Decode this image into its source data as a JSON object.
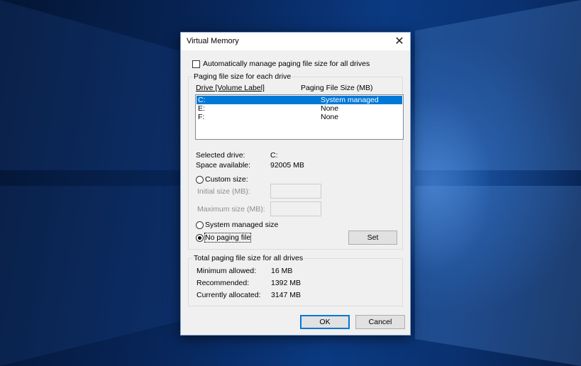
{
  "window": {
    "title": "Virtual Memory"
  },
  "auto_manage": {
    "label": "Automatically manage paging file size for all drives",
    "checked": false
  },
  "paging_group": {
    "title": "Paging file size for each drive",
    "headers": {
      "drive": "Drive  [Volume Label]",
      "size": "Paging File Size (MB)"
    },
    "rows": [
      {
        "drive": "C:",
        "size": "System managed",
        "selected": true
      },
      {
        "drive": "E:",
        "size": "None",
        "selected": false
      },
      {
        "drive": "F:",
        "size": "None",
        "selected": false
      }
    ],
    "selected_drive": {
      "label": "Selected drive:",
      "value": "C:"
    },
    "space_available": {
      "label": "Space available:",
      "value": "92005 MB"
    },
    "custom_size": {
      "label": "Custom size:",
      "selected": false
    },
    "initial_size": {
      "label": "Initial size (MB):",
      "value": ""
    },
    "maximum_size": {
      "label": "Maximum size (MB):",
      "value": ""
    },
    "system_managed": {
      "label": "System managed size",
      "selected": false
    },
    "no_paging": {
      "label": "No paging file",
      "selected": true
    },
    "set_button": "Set"
  },
  "total_group": {
    "title": "Total paging file size for all drives",
    "minimum": {
      "label": "Minimum allowed:",
      "value": "16 MB"
    },
    "recommended": {
      "label": "Recommended:",
      "value": "1392 MB"
    },
    "current": {
      "label": "Currently allocated:",
      "value": "3147 MB"
    }
  },
  "buttons": {
    "ok": "OK",
    "cancel": "Cancel"
  },
  "colors": {
    "selection": "#0078d7",
    "dialog_bg": "#f0f0f0",
    "desktop": "#0b3a82"
  }
}
